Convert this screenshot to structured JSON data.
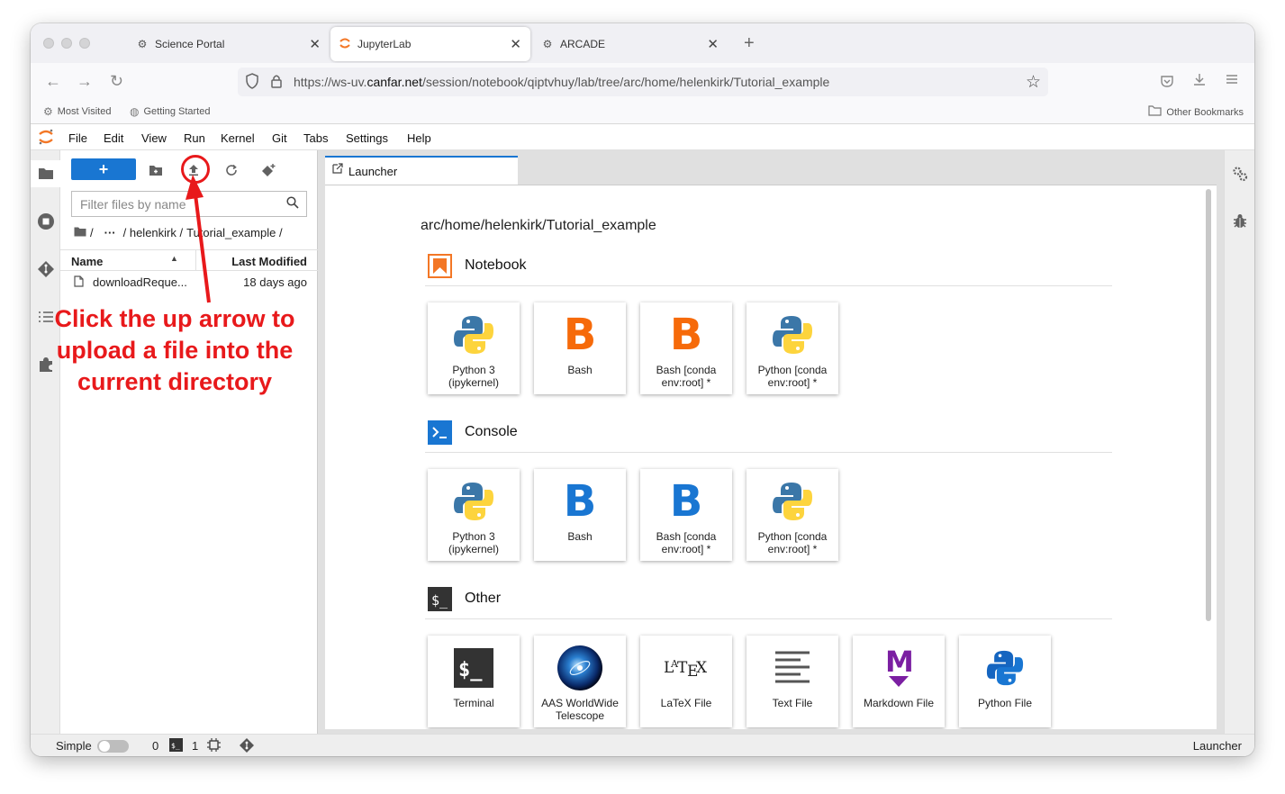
{
  "browser": {
    "tabs": [
      {
        "title": "Science Portal"
      },
      {
        "title": "JupyterLab"
      },
      {
        "title": "ARCADE"
      }
    ],
    "url_prefix": "https://ws-uv.",
    "url_host": "canfar.net",
    "url_path": "/session/notebook/qiptvhuy/lab/tree/arc/home/helenkirk/Tutorial_example",
    "bookmarks": [
      {
        "label": "Most Visited"
      },
      {
        "label": "Getting Started"
      }
    ],
    "other_bookmarks": "Other Bookmarks"
  },
  "menu": [
    "File",
    "Edit",
    "View",
    "Run",
    "Kernel",
    "Git",
    "Tabs",
    "Settings",
    "Help"
  ],
  "filebrowser": {
    "new_label": "+",
    "filter_placeholder": "Filter files by name",
    "crumbs": {
      "root": "/",
      "ellipsis": "···",
      "user": "/ helenkirk /",
      "folder": "Tutorial_example /"
    },
    "columns": {
      "name": "Name",
      "modified": "Last Modified"
    },
    "files": [
      {
        "name": "downloadReque...",
        "modified": "18 days ago"
      }
    ]
  },
  "annotation": {
    "lines": [
      "Click the up arrow to",
      "upload a file into the",
      "current directory"
    ],
    "color": "#e8191b"
  },
  "launcher": {
    "tab_label": "Launcher",
    "cwd": "arc/home/helenkirk/Tutorial_example",
    "sections": [
      {
        "title": "Notebook",
        "cards": [
          {
            "label": "Python 3 (ipykernel)",
            "icon": "python-logo"
          },
          {
            "label": "Bash",
            "icon": "bash-b-orange"
          },
          {
            "label": "Bash [conda env:root] *",
            "icon": "bash-b-orange"
          },
          {
            "label": "Python [conda env:root] *",
            "icon": "python-logo"
          }
        ]
      },
      {
        "title": "Console",
        "cards": [
          {
            "label": "Python 3 (ipykernel)",
            "icon": "python-logo"
          },
          {
            "label": "Bash",
            "icon": "bash-b-blue"
          },
          {
            "label": "Bash [conda env:root] *",
            "icon": "bash-b-blue"
          },
          {
            "label": "Python [conda env:root] *",
            "icon": "python-logo"
          }
        ]
      },
      {
        "title": "Other",
        "cards": [
          {
            "label": "Terminal",
            "icon": "terminal-icon"
          },
          {
            "label": "AAS WorldWide Telescope",
            "icon": "telescope-globe"
          },
          {
            "label": "LaTeX File",
            "icon": "latex-logo"
          },
          {
            "label": "Text File",
            "icon": "text-lines-icon"
          },
          {
            "label": "Markdown File",
            "icon": "markdown-m-icon"
          },
          {
            "label": "Python File",
            "icon": "python-logo-blue"
          }
        ]
      }
    ]
  },
  "statusbar": {
    "mode_label": "Simple",
    "terminals_count": "0",
    "kernels_count": "1",
    "current_activity": "Launcher"
  },
  "colors": {
    "jupyter_blue": "#1976d2",
    "bash_orange": "#f66a0a",
    "bash_blue": "#1976d2",
    "notebook_badge": "#f37726",
    "markdown_purple": "#7b1fa2"
  }
}
